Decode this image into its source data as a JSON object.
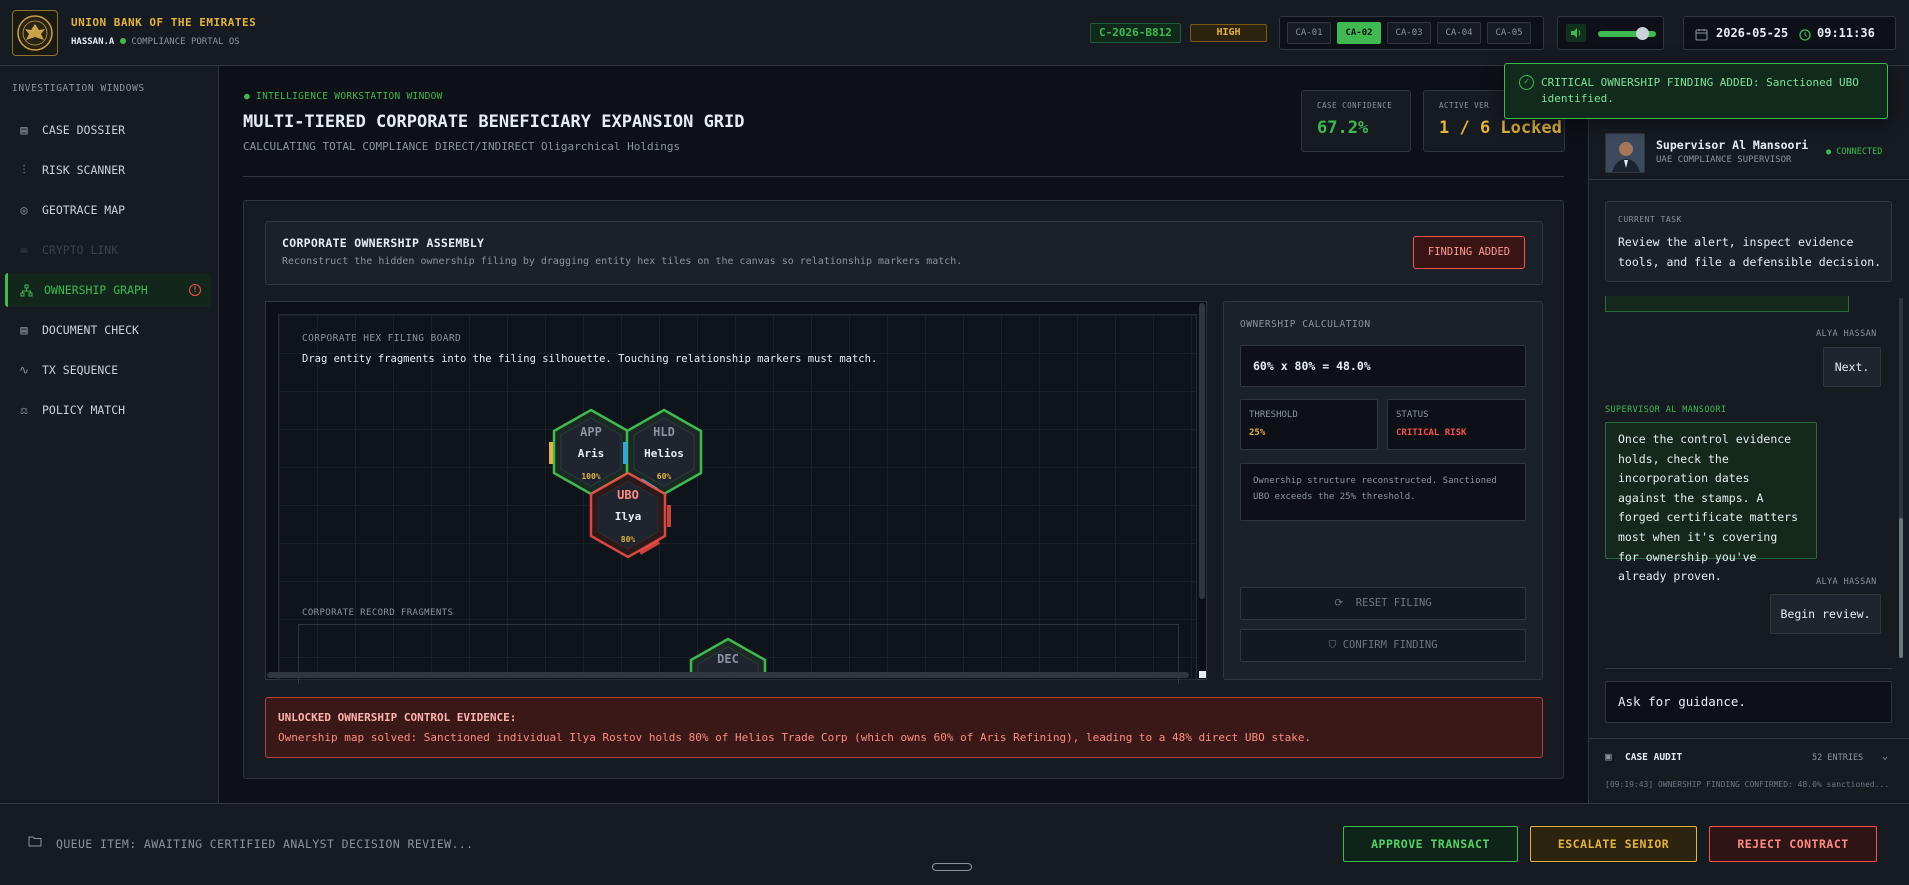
{
  "header": {
    "bank_name": "UNION BANK OF THE EMIRATES",
    "user": "HASSAN.A",
    "portal": "COMPLIANCE PORTAL OS",
    "case_id": "C-2026-B812",
    "severity": "HIGH",
    "case_tabs": [
      "CA-01",
      "CA-02",
      "CA-03",
      "CA-04",
      "CA-05"
    ],
    "active_tab": "CA-02",
    "volume_level_percent": 75,
    "date": "2026-05-25",
    "time": "09:11:36"
  },
  "sidebar": {
    "title": "INVESTIGATION WINDOWS",
    "items": [
      {
        "label": "CASE DOSSIER",
        "icon": "document-icon",
        "state": "normal"
      },
      {
        "label": "RISK SCANNER",
        "icon": "sliders-icon",
        "state": "normal"
      },
      {
        "label": "GEOTRACE MAP",
        "icon": "compass-icon",
        "state": "normal"
      },
      {
        "label": "CRYPTO LINK",
        "icon": "link-icon",
        "state": "disabled"
      },
      {
        "label": "OWNERSHIP GRAPH",
        "icon": "network-icon",
        "state": "active"
      },
      {
        "label": "DOCUMENT CHECK",
        "icon": "document-icon",
        "state": "normal"
      },
      {
        "label": "TX SEQUENCE",
        "icon": "activity-icon",
        "state": "normal"
      },
      {
        "label": "POLICY MATCH",
        "icon": "scale-icon",
        "state": "normal"
      }
    ]
  },
  "workstation": {
    "tag": "INTELLIGENCE WORKSTATION WINDOW",
    "title": "MULTI-TIERED CORPORATE BENEFICIARY EXPANSION GRID",
    "subtitle": "CALCULATING TOTAL COMPLIANCE DIRECT/INDIRECT Oligarchical Holdings",
    "stats": [
      {
        "label": "CASE CONFIDENCE",
        "value": "67.2%",
        "color": "#3fb950"
      },
      {
        "label": "ACTIVE VER",
        "value": "1 / 6 Locked",
        "color": "#e3b341"
      }
    ]
  },
  "assembly": {
    "title": "CORPORATE OWNERSHIP ASSEMBLY",
    "subtitle": "Reconstruct the hidden ownership filing by dragging entity hex tiles on the canvas so relationship markers match.",
    "status_button": "FINDING ADDED"
  },
  "board": {
    "title": "CORPORATE HEX FILING BOARD",
    "subtitle": "Drag entity fragments into the filing silhouette. Touching relationship markers must match.",
    "tiles": [
      {
        "code": "APP",
        "name": "Aris",
        "pct": "100%",
        "kind": "app"
      },
      {
        "code": "HLD",
        "name": "Helios",
        "pct": "60%",
        "kind": "hld"
      },
      {
        "code": "UBO",
        "name": "Ilya",
        "pct": "80%",
        "kind": "ubo"
      }
    ],
    "fragments_title": "CORPORATE RECORD FRAGMENTS",
    "fragment_tile": {
      "code": "DEC"
    }
  },
  "calculation": {
    "title": "OWNERSHIP CALCULATION",
    "formula": "60% x 80% = 48.0%",
    "threshold_label": "THRESHOLD",
    "threshold_value": "25%",
    "status_label": "STATUS",
    "status_value": "CRITICAL RISK",
    "note": "Ownership structure reconstructed. Sanctioned UBO exceeds the 25% threshold.",
    "reset_label": "RESET FILING",
    "confirm_label": "CONFIRM FINDING"
  },
  "evidence": {
    "heading": "UNLOCKED OWNERSHIP CONTROL EVIDENCE:",
    "body": "Ownership map solved: Sanctioned individual Ilya Rostov holds 80% of Helios Trade Corp (which owns 60% of Aris Refining), leading to a 48% direct UBO stake."
  },
  "toast": {
    "text": "CRITICAL OWNERSHIP FINDING ADDED: Sanctioned UBO identified."
  },
  "supervisor": {
    "name": "Supervisor Al Mansoori",
    "role": "UAE COMPLIANCE SUPERVISOR",
    "status": "CONNECTED",
    "task_label": "CURRENT TASK",
    "task": "Review the alert, inspect evidence tools, and file a defensible decision."
  },
  "chat": {
    "user_name": "ALYA HASSAN",
    "supervisor_name": "SUPERVISOR AL MANSOORI",
    "msg_next": "Next.",
    "msg_supervisor": "Once the control evidence holds, check the incorporation dates against the stamps. A forged certificate matters most when it's covering for ownership you've already proven.",
    "msg_begin": "Begin review.",
    "input_placeholder": "Ask for guidance."
  },
  "audit": {
    "title": "CASE AUDIT",
    "count": "52 ENTRIES",
    "latest": "[09:19:43] OWNERSHIP FINDING CONFIRMED: 48.0% sanctioned..."
  },
  "footer": {
    "queue": "QUEUE ITEM: AWAITING CERTIFIED ANALYST DECISION REVIEW...",
    "approve": "APPROVE TRANSACT",
    "escalate": "ESCALATE SENIOR",
    "reject": "REJECT CONTRACT"
  },
  "colors": {
    "accent_green": "#3fb950",
    "accent_gold": "#e3b341",
    "accent_red": "#f85149"
  }
}
